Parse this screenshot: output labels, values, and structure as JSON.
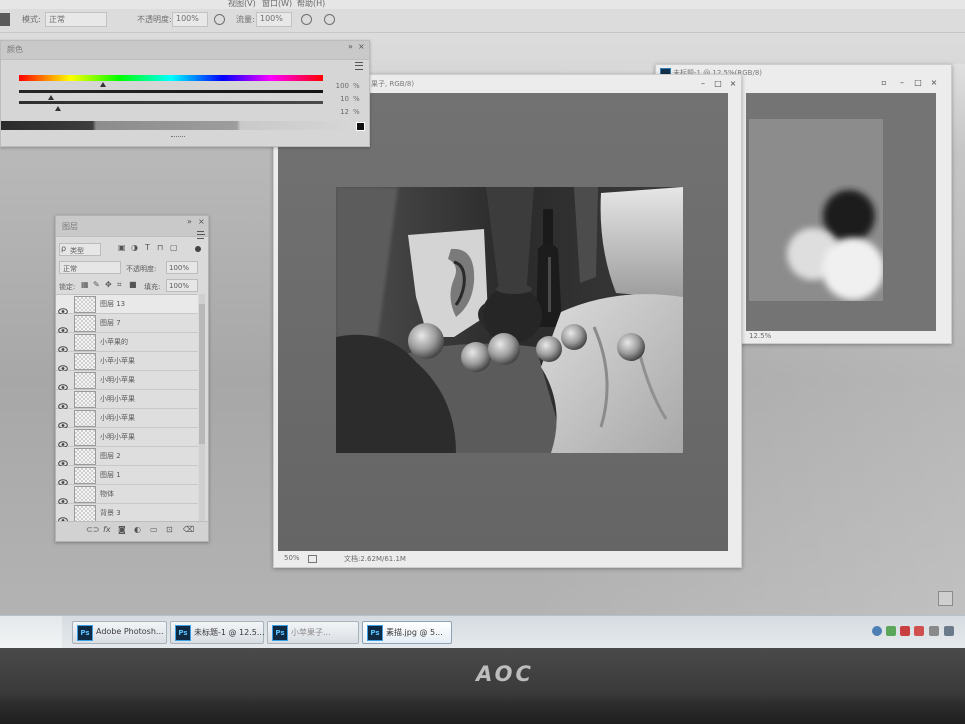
{
  "menu": {
    "items": [
      "视图(V)",
      "窗口(W)",
      "帮助(H)"
    ]
  },
  "options_bar": {
    "mode_label": "模式:",
    "mode_value": "正常",
    "opacity_label": "不透明度:",
    "opacity_value": "100%",
    "flow_label": "流量:",
    "flow_value": "100%"
  },
  "color_panel": {
    "title": "颜色",
    "values": [
      "100",
      "10",
      "12"
    ],
    "unit": "%"
  },
  "layers_panel": {
    "title": "图层",
    "filter_kind": "类型",
    "blend_mode": "正常",
    "opacity_label": "不透明度:",
    "opacity_value": "100%",
    "lock_label": "锁定:",
    "fill_label": "填充:",
    "fill_value": "100%",
    "layers": [
      {
        "name": "图层 13"
      },
      {
        "name": "图层 7"
      },
      {
        "name": "小苹果的"
      },
      {
        "name": "小苹小苹果"
      },
      {
        "name": "小明小苹果"
      },
      {
        "name": "小明小苹果"
      },
      {
        "name": "小明小苹果"
      },
      {
        "name": "小明小苹果"
      },
      {
        "name": "图层 2"
      },
      {
        "name": "图层 1"
      },
      {
        "name": "物体"
      },
      {
        "name": "背景 3"
      }
    ]
  },
  "documents": {
    "main": {
      "title": "果子, RGB/8)",
      "zoom": "50%",
      "info": "文档:2.62M/61.1M"
    },
    "secondary": {
      "title": "未标题-1 @ 12.5%(RGB/8)",
      "zoom": "12.5%"
    }
  },
  "taskbar": {
    "items": [
      {
        "icon": "Ps",
        "label": "Adobe Photosh..."
      },
      {
        "icon": "Ps",
        "label": "未标题-1 @ 12.5..."
      },
      {
        "icon": "Ps",
        "label": "小苹果子..."
      },
      {
        "icon": "Ps",
        "label": "素描.jpg @ 5..."
      }
    ]
  },
  "monitor": {
    "brand": "AOC"
  },
  "colors": {
    "ps_icon_bg": "#0f2b44",
    "ps_icon_text": "#5cc2ff",
    "canvas_gray": "#6b6b6b"
  }
}
